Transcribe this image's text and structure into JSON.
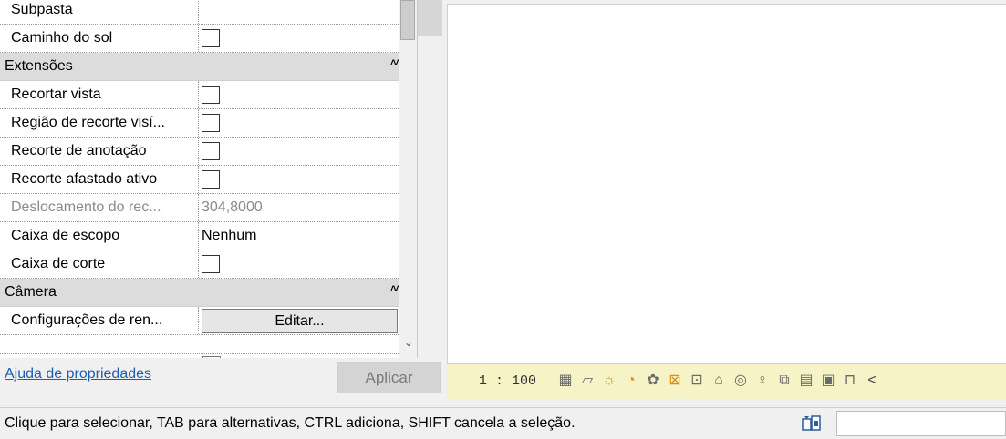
{
  "properties": {
    "rows": [
      {
        "type": "prop",
        "label": "Subpasta",
        "value": "",
        "kind": "text"
      },
      {
        "type": "prop",
        "label": "Caminho do sol",
        "kind": "checkbox",
        "checked": false
      },
      {
        "type": "category",
        "label": "Extensões"
      },
      {
        "type": "prop",
        "label": "Recortar vista",
        "kind": "checkbox",
        "checked": false
      },
      {
        "type": "prop",
        "label": "Região de recorte visí...",
        "kind": "checkbox",
        "checked": false
      },
      {
        "type": "prop",
        "label": "Recorte de anotação",
        "kind": "checkbox",
        "checked": false
      },
      {
        "type": "prop",
        "label": "Recorte afastado ativo",
        "kind": "checkbox",
        "checked": false
      },
      {
        "type": "prop",
        "label": "Deslocamento do rec...",
        "value": "304,8000",
        "kind": "text",
        "disabled": true
      },
      {
        "type": "prop",
        "label": "Caixa de escopo",
        "value": "Nenhum",
        "kind": "text"
      },
      {
        "type": "prop",
        "label": "Caixa de corte",
        "kind": "checkbox",
        "checked": false
      },
      {
        "type": "category",
        "label": "Câmera"
      },
      {
        "type": "prop",
        "label": "Configurações de ren...",
        "kind": "button",
        "button_label": "Editar..."
      }
    ],
    "help_link": "Ajuda de propriedades",
    "apply_label": "Aplicar"
  },
  "view_toolbar": {
    "scale": "1 : 100",
    "icons": [
      {
        "name": "detail-level-icon",
        "glyph": "▦",
        "color": "#6b6b6b"
      },
      {
        "name": "visual-style-icon",
        "glyph": "▱",
        "color": "#6b6b6b"
      },
      {
        "name": "sun-path-icon",
        "glyph": "☼",
        "color": "#e38a14"
      },
      {
        "name": "shadows-icon",
        "glyph": "◔",
        "color": "#e38a14"
      },
      {
        "name": "rendering-icon",
        "glyph": "✿",
        "color": "#6b6b6b"
      },
      {
        "name": "crop-view-icon",
        "glyph": "⊠",
        "color": "#e38a14"
      },
      {
        "name": "crop-region-icon",
        "glyph": "⊡",
        "color": "#6b6b6b"
      },
      {
        "name": "unlocked-3d-view-icon",
        "glyph": "⌂",
        "color": "#6b6b6b"
      },
      {
        "name": "temporary-hide-icon",
        "glyph": "◎",
        "color": "#6b6b6b"
      },
      {
        "name": "reveal-hidden-icon",
        "glyph": "♀",
        "color": "#6b6b6b"
      },
      {
        "name": "worksharing-display-icon",
        "glyph": "⧉",
        "color": "#6b6b6b"
      },
      {
        "name": "temporary-view-properties-icon",
        "glyph": "▤",
        "color": "#6b6b6b"
      },
      {
        "name": "show-analytical-model-icon",
        "glyph": "▣",
        "color": "#6b6b6b"
      },
      {
        "name": "highlight-displacement-icon",
        "glyph": "⊓",
        "color": "#6b6b6b"
      },
      {
        "name": "more-chevron-icon",
        "glyph": "<",
        "color": "#444444"
      }
    ]
  },
  "status": {
    "message": "Clique para selecionar, TAB para alternativas, CTRL adiciona, SHIFT cancela a seleção.",
    "field_value": ""
  }
}
